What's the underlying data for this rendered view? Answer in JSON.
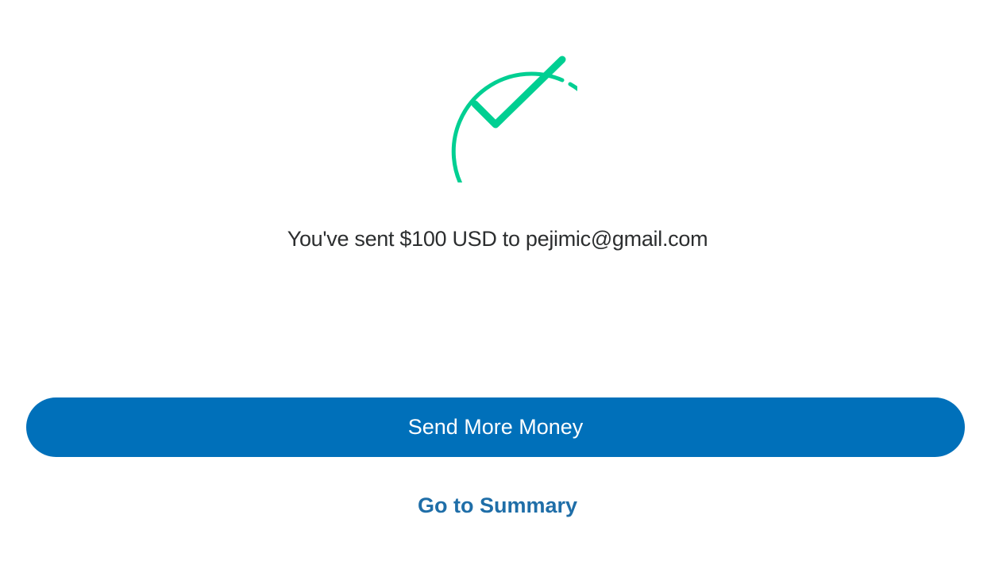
{
  "confirmation": {
    "message": "You've sent $100 USD to pejimic@gmail.com",
    "icon": "checkmark-circle-icon",
    "icon_color": "#00cf92"
  },
  "actions": {
    "primary_label": "Send More Money",
    "primary_color": "#0070ba",
    "secondary_label": "Go to Summary",
    "secondary_color": "#1f6ea8"
  }
}
